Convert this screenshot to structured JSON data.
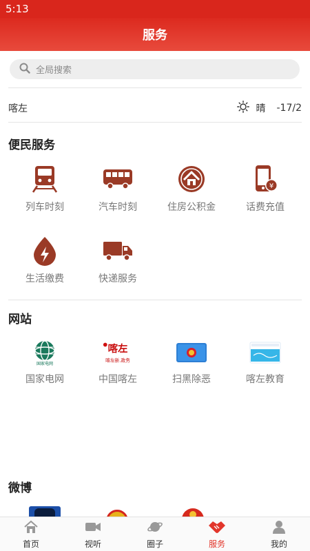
{
  "status_bar": {
    "time": "5:13"
  },
  "header": {
    "title": "服务"
  },
  "search": {
    "placeholder": "全局搜索"
  },
  "weather": {
    "city": "喀左",
    "condition": "晴",
    "temperature": "-17/2"
  },
  "sections": {
    "services": {
      "title": "便民服务",
      "items": [
        {
          "label": "列车时刻",
          "icon": "train-icon"
        },
        {
          "label": "汽车时刻",
          "icon": "bus-icon"
        },
        {
          "label": "住房公积金",
          "icon": "house-fund-icon"
        },
        {
          "label": "话费充值",
          "icon": "phone-recharge-icon"
        },
        {
          "label": "生活缴费",
          "icon": "utility-payment-icon"
        },
        {
          "label": "快递服务",
          "icon": "delivery-truck-icon"
        }
      ]
    },
    "websites": {
      "title": "网站",
      "items": [
        {
          "label": "国家电网",
          "icon": "state-grid-logo",
          "logo_text": "国家电网"
        },
        {
          "label": "中国喀左",
          "icon": "china-kazuo-logo",
          "logo_text": "喀左",
          "logo_subtext": "喀左新.政务"
        },
        {
          "label": "扫黑除恶",
          "icon": "anti-crime-logo"
        },
        {
          "label": "喀左教育",
          "icon": "kazuo-education-logo"
        }
      ]
    },
    "weibo": {
      "title": "微博"
    }
  },
  "tab_bar": {
    "items": [
      {
        "label": "首页",
        "icon": "home-icon"
      },
      {
        "label": "视听",
        "icon": "video-camera-icon"
      },
      {
        "label": "圈子",
        "icon": "planet-icon"
      },
      {
        "label": "服务",
        "icon": "handshake-icon"
      },
      {
        "label": "我的",
        "icon": "user-icon"
      }
    ],
    "active_index": 3
  },
  "colors": {
    "brand_red": "#e2362b",
    "icon_brown": "#9a3a26",
    "text_gray": "#777777"
  }
}
